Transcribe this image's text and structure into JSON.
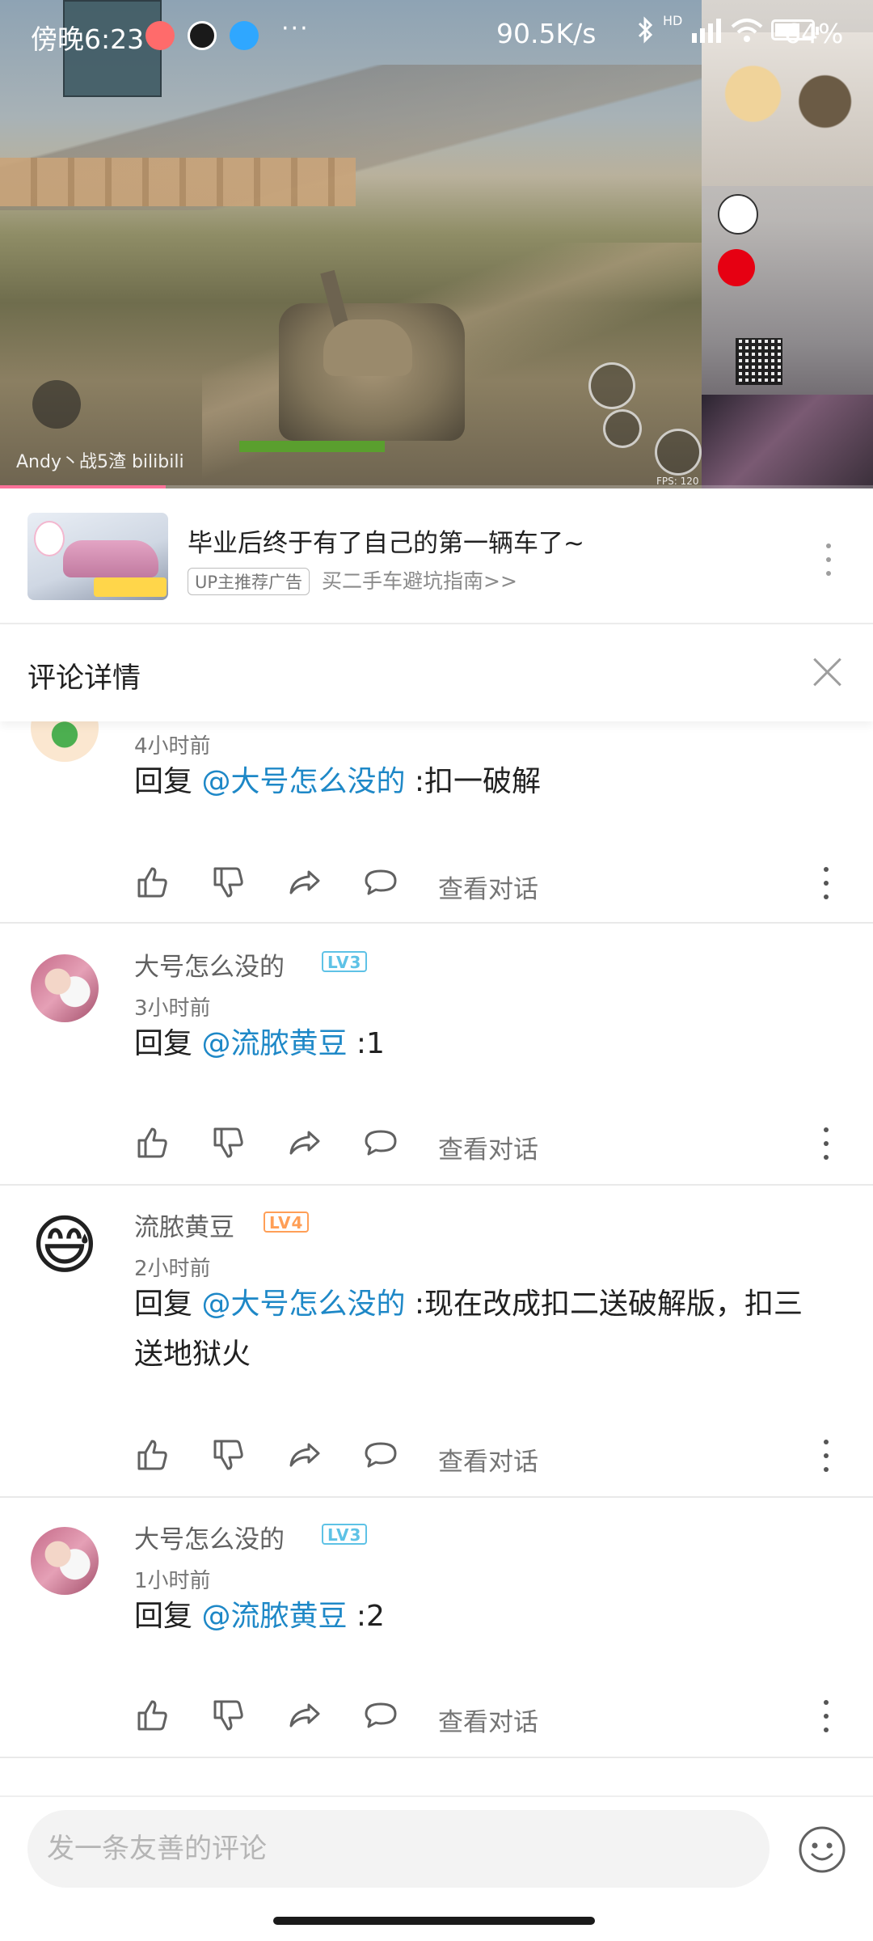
{
  "status_bar": {
    "time": "傍晚6:23",
    "more": "···",
    "network_speed": "90.5K/s",
    "hd": "HD",
    "battery": "64%"
  },
  "video": {
    "watermark": "Andy丶战5渣 bilibili",
    "fps": "FPS: 120",
    "progress": 0.19
  },
  "ad": {
    "title": "毕业后终于有了自己的第一辆车了~",
    "badge": "UP主推荐广告",
    "subtitle": "买二手车避坑指南>>"
  },
  "detail": {
    "title": "评论详情"
  },
  "comments": [
    {
      "time": "4小时前",
      "reply_prefix": "回复 ",
      "mention": "@大号怎么没的",
      "body": " :扣一破解",
      "view_thread": "查看对话"
    },
    {
      "name": "大号怎么没的",
      "level": "LV3",
      "time": "3小时前",
      "reply_prefix": "回复 ",
      "mention": "@流脓黄豆",
      "body": " :1",
      "view_thread": "查看对话"
    },
    {
      "name": "流脓黄豆",
      "level": "LV4",
      "time": "2小时前",
      "reply_prefix": "回复 ",
      "mention": "@大号怎么没的",
      "body": " :现在改成扣二送破解版，扣三送地狱火",
      "view_thread": "查看对话"
    },
    {
      "name": "大号怎么没的",
      "level": "LV3",
      "time": "1小时前",
      "reply_prefix": "回复 ",
      "mention": "@流脓黄豆",
      "body": " :2",
      "view_thread": "查看对话"
    }
  ],
  "input": {
    "placeholder": "发一条友善的评论"
  },
  "colors": {
    "mention": "#1e88c7",
    "lv3": "#5ec2e6",
    "lv4": "#ff9f57",
    "progress": "#fb7299"
  },
  "icons": [
    "like-icon",
    "dislike-icon",
    "share-icon",
    "reply-icon",
    "more-icon",
    "close-icon",
    "emoji-icon"
  ]
}
